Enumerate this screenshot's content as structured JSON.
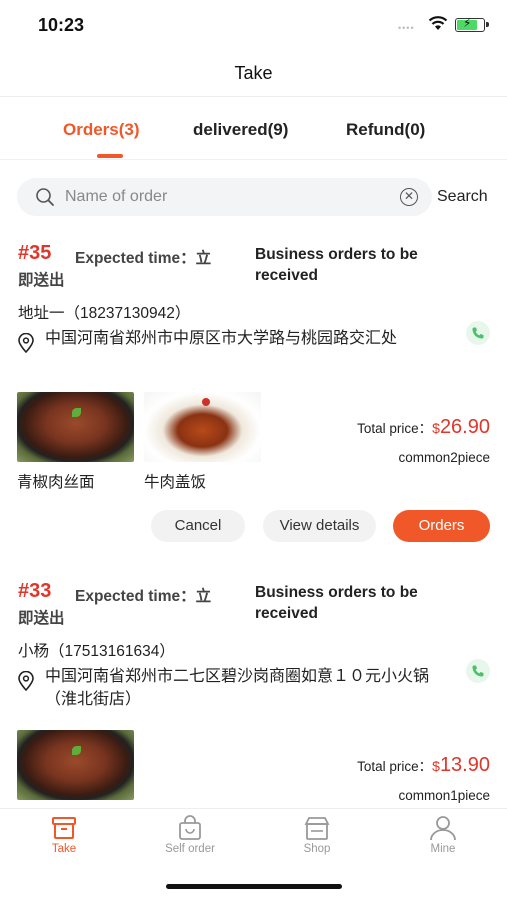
{
  "status": {
    "time": "10:23"
  },
  "header": {
    "title": "Take"
  },
  "tabs": [
    {
      "label": "Orders(3)",
      "active": true
    },
    {
      "label": "delivered(9)",
      "active": false
    },
    {
      "label": "Refund(0)",
      "active": false
    }
  ],
  "search": {
    "placeholder": "Name of order",
    "button": "Search"
  },
  "orders": [
    {
      "number": "#35",
      "expected_label": "Expected time：立",
      "expected_cont": "即送出",
      "business_status": "Business orders to be received",
      "customer": "地址一（18237130942）",
      "address": "中国河南省郑州市中原区市大学路与桃园路交汇处",
      "dishes": [
        {
          "name": "青椒肉丝面",
          "image": "noodle"
        },
        {
          "name": "牛肉盖饭",
          "image": "rice"
        }
      ],
      "total_label": "Total price：",
      "currency": "$",
      "total_price": "26.90",
      "count": "common2piece",
      "actions": {
        "cancel": "Cancel",
        "details": "View details",
        "primary": "Orders"
      }
    },
    {
      "number": "#33",
      "expected_label": "Expected time：立",
      "expected_cont": "即送出",
      "business_status": "Business orders to be received",
      "customer": "小杨（17513161634）",
      "address": "中国河南省郑州市二七区碧沙岗商圈如意１０元小火锅（淮北街店）",
      "dishes": [
        {
          "name": "",
          "image": "noodle"
        }
      ],
      "total_label": "Total price：",
      "currency": "$",
      "total_price": "13.90",
      "count": "common1piece"
    }
  ],
  "tabbar": [
    {
      "label": "Take",
      "icon": "take-box-icon",
      "active": true
    },
    {
      "label": "Self order",
      "icon": "bag-icon",
      "active": false
    },
    {
      "label": "Shop",
      "icon": "shop-icon",
      "active": false
    },
    {
      "label": "Mine",
      "icon": "user-icon",
      "active": false
    }
  ],
  "colors": {
    "accent": "#f0582a",
    "price": "#e0362a",
    "phone_green": "#4cc06a"
  }
}
